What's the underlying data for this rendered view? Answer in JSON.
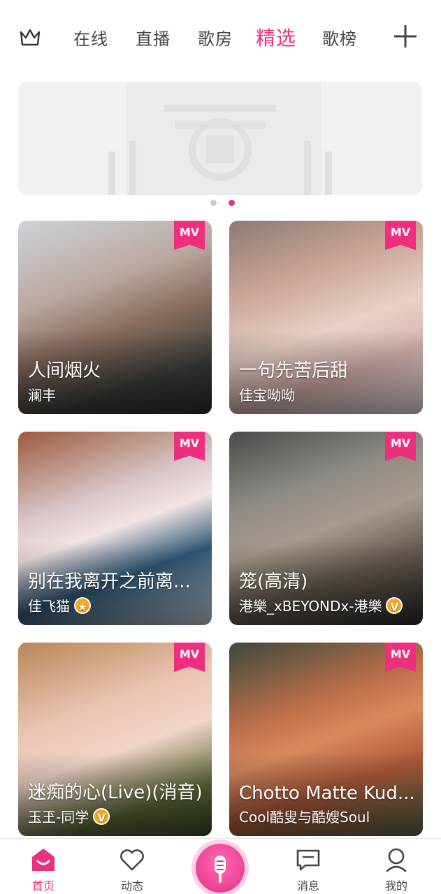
{
  "header": {
    "tabs": [
      {
        "label": "在线"
      },
      {
        "label": "直播"
      },
      {
        "label": "歌房"
      },
      {
        "label": "精选",
        "active": true
      },
      {
        "label": "歌榜"
      }
    ],
    "crown_icon": "crown-icon",
    "add_icon": "plus-icon"
  },
  "banner": {
    "placeholder_icon": "image-placeholder-icon",
    "dots": 2,
    "active_dot": 1
  },
  "colors": {
    "accent": "#e8327d",
    "mv_badge": "#ee2f7e",
    "vip_badge": "#f5a623"
  },
  "cards": [
    {
      "badge": "MV",
      "title": "人间烟火",
      "author": "澜丰",
      "author_badge": ""
    },
    {
      "badge": "MV",
      "title": "一句先苦后甜",
      "author": "佳宝呦呦",
      "author_badge": ""
    },
    {
      "badge": "MV",
      "title": "别在我离开之前离...",
      "author": "佳飞猫",
      "author_badge": "★"
    },
    {
      "badge": "MV",
      "title": "笼(高清)",
      "author": "港樂_xBEYONDx-港樂",
      "author_badge": "V"
    },
    {
      "badge": "MV",
      "title": "迷痴的心(Live)(消音)",
      "author": "玉玊-同学",
      "author_badge": "V"
    },
    {
      "badge": "MV",
      "title": "Chotto Matte Kud...",
      "author": "Cool酷叟与酷嫂Soul",
      "author_badge": ""
    }
  ],
  "bottom_nav": {
    "items": [
      {
        "label": "首页",
        "icon": "home-icon",
        "active": true
      },
      {
        "label": "动态",
        "icon": "heart-icon"
      },
      {
        "label": "",
        "icon": "microphone-icon"
      },
      {
        "label": "消息",
        "icon": "message-icon"
      },
      {
        "label": "我的",
        "icon": "profile-icon"
      }
    ]
  }
}
